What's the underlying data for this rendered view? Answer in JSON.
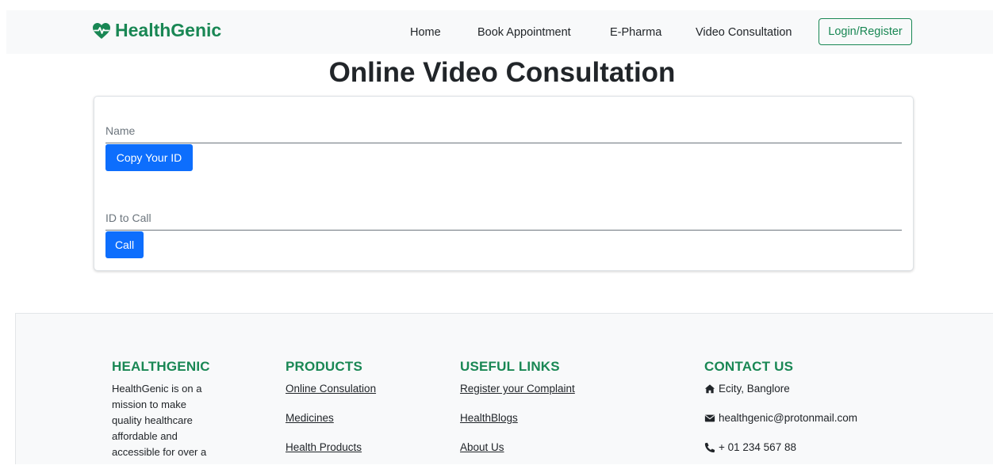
{
  "brand": {
    "name": "HealthGenic",
    "icon": "heartbeat-icon",
    "color": "#198754"
  },
  "nav": {
    "items": [
      {
        "label": "Home"
      },
      {
        "label": "Book Appointment"
      },
      {
        "label": "E-Pharma"
      },
      {
        "label": "Video Consultation"
      }
    ],
    "login_label": "Login/Register"
  },
  "main": {
    "title": "Online Video Consultation",
    "name_field": {
      "placeholder": "Name",
      "value": ""
    },
    "copy_button": "Copy Your ID",
    "id_field": {
      "placeholder": "ID to Call",
      "value": ""
    },
    "call_button": "Call"
  },
  "footer": {
    "about": {
      "heading": "HEALTHGENIC",
      "text": "HealthGenic is on a mission to make quality healthcare affordable and accessible for over a"
    },
    "products": {
      "heading": "PRODUCTS",
      "links": [
        "Online Consulation",
        "Medicines",
        "Health Products"
      ]
    },
    "useful_links": {
      "heading": "USEFUL LINKS",
      "links": [
        "Register your Complaint",
        "HealthBlogs",
        "About Us"
      ]
    },
    "contact": {
      "heading": "CONTACT US",
      "items": [
        {
          "icon": "home-icon",
          "text": "Ecity, Banglore"
        },
        {
          "icon": "envelope-icon",
          "text": "healthgenic@protonmail.com"
        },
        {
          "icon": "phone-icon",
          "text": "+ 01 234 567 88"
        }
      ]
    }
  },
  "colors": {
    "accent_green": "#198754",
    "primary_blue": "#0d6efd",
    "navbar_bg": "#f8f9fa"
  }
}
